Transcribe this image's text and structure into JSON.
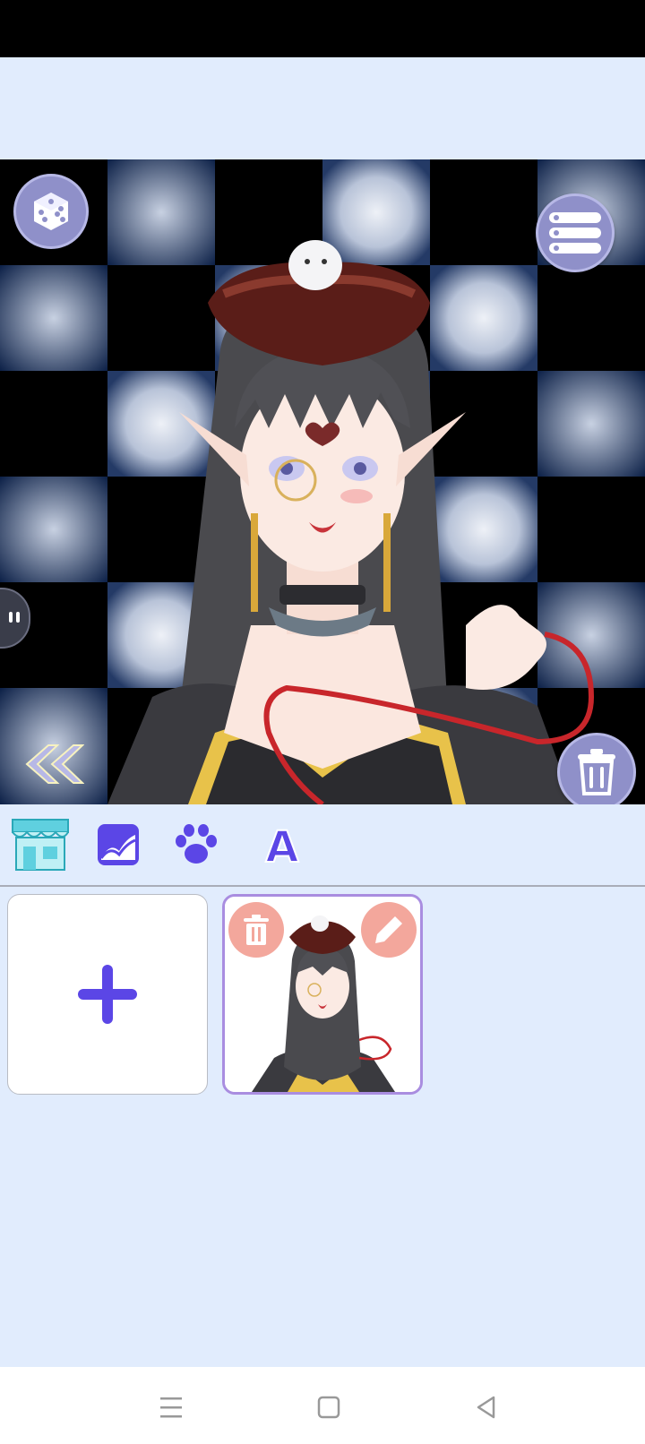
{
  "app": {
    "icons": {
      "randomize": "dice-icon",
      "menu": "list-menu-icon",
      "delete": "trash-icon",
      "collapse": "double-chevron-left-icon",
      "shop": "shop-icon",
      "background": "landscape-image-icon",
      "pets": "paw-icon",
      "text": "letter-a-icon",
      "add": "plus-icon",
      "edit": "pencil-icon"
    },
    "tabs": [
      {
        "name": "shop",
        "icon": "shop-icon"
      },
      {
        "name": "background",
        "icon": "landscape-image-icon"
      },
      {
        "name": "pets",
        "icon": "paw-icon"
      },
      {
        "name": "text",
        "icon": "letter-a-icon",
        "glyph": "A"
      }
    ],
    "colors": {
      "page_bg": "#e1ecfd",
      "accent": "#5b46e6",
      "button_bg": "#8f90c9",
      "card_border": "#a98de0",
      "card_action": "#f3a79c",
      "shop_icon": "#5fd0df"
    }
  },
  "navigation": {
    "buttons": [
      "recents-icon",
      "home-icon",
      "back-icon"
    ]
  }
}
